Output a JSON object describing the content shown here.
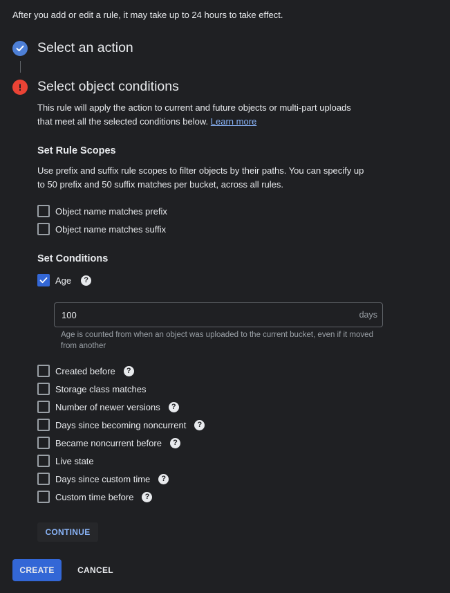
{
  "notice": "After you add or edit a rule, it may take up to 24 hours to take effect.",
  "steps": {
    "action": {
      "title": "Select an action",
      "status": "complete",
      "icon": "check-circle-icon"
    },
    "conditions": {
      "title": "Select object conditions",
      "status": "error",
      "icon": "error-circle-icon"
    }
  },
  "conditions_intro": {
    "text": "This rule will apply the action to current and future objects or multi-part uploads that meet all the selected conditions below.",
    "link": "Learn more"
  },
  "scopes": {
    "title": "Set Rule Scopes",
    "description": "Use prefix and suffix rule scopes to filter objects by their paths. You can specify up to 50 prefix and 50 suffix matches per bucket, across all rules.",
    "items": [
      {
        "label": "Object name matches prefix",
        "checked": false
      },
      {
        "label": "Object name matches suffix",
        "checked": false
      }
    ]
  },
  "conditions": {
    "title": "Set Conditions",
    "age": {
      "label": "Age",
      "checked": true,
      "value": "100",
      "unit": "days",
      "hint": "Age is counted from when an object was uploaded to the current bucket, even if it moved from another"
    },
    "items": [
      {
        "label": "Created before",
        "checked": false,
        "help": true
      },
      {
        "label": "Storage class matches",
        "checked": false,
        "help": false
      },
      {
        "label": "Number of newer versions",
        "checked": false,
        "help": true
      },
      {
        "label": "Days since becoming noncurrent",
        "checked": false,
        "help": true
      },
      {
        "label": "Became noncurrent before",
        "checked": false,
        "help": true
      },
      {
        "label": "Live state",
        "checked": false,
        "help": false
      },
      {
        "label": "Days since custom time",
        "checked": false,
        "help": true
      },
      {
        "label": "Custom time before",
        "checked": false,
        "help": true
      }
    ]
  },
  "buttons": {
    "continue": "CONTINUE",
    "create": "CREATE",
    "cancel": "CANCEL"
  },
  "colors": {
    "background": "#1f2023",
    "accent": "#3367d6",
    "link": "#8ab4f8",
    "error": "#ea4335"
  }
}
